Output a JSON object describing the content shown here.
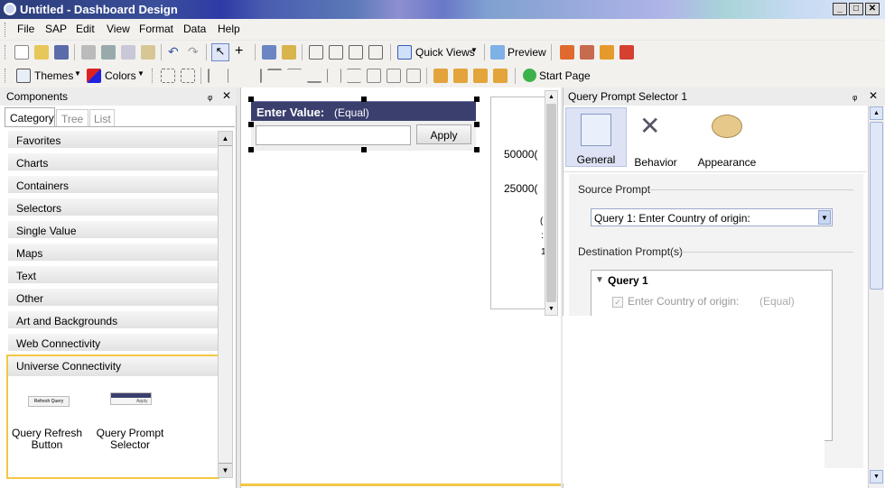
{
  "window": {
    "title": "Untitled - Dashboard Design",
    "min_glyph": "_",
    "max_glyph": "□",
    "close_glyph": "✕"
  },
  "menu": [
    "File",
    "SAP",
    "Edit",
    "View",
    "Format",
    "Data",
    "Help"
  ],
  "toolbar1": {
    "quick_views": "Quick Views",
    "preview": "Preview"
  },
  "toolbar2": {
    "themes": "Themes",
    "colors": "Colors",
    "start_page": "Start Page"
  },
  "components": {
    "title": "Components",
    "pin_glyph": "ᵩ",
    "close_glyph": "✕",
    "tabs": [
      "Category",
      "Tree",
      "List"
    ],
    "categories": [
      "Favorites",
      "Charts",
      "Containers",
      "Selectors",
      "Single Value",
      "Maps",
      "Text",
      "Other",
      "Art and Backgrounds",
      "Web Connectivity"
    ],
    "expanded": {
      "name": "Universe Connectivity",
      "items": [
        {
          "label": "Query Refresh Button",
          "line1": "Query Refresh",
          "line2": "Button",
          "thumb_text": "Refresh Query"
        },
        {
          "label": "Query Prompt Selector",
          "line1": "Query Prompt",
          "line2": "Selector",
          "thumb_text": "Apply"
        }
      ]
    }
  },
  "canvas": {
    "widget_title": "Enter Value:",
    "widget_subtitle": "(Equal)",
    "apply_label": "Apply",
    "input_value": "",
    "chart_labels": [
      "50000(",
      "25000(",
      "(",
      ":",
      "1"
    ]
  },
  "properties": {
    "title": "Query Prompt Selector 1",
    "pin_glyph": "ᵩ",
    "close_glyph": "✕",
    "tabs": [
      "General",
      "Behavior",
      "Appearance"
    ],
    "source_prompt_label": "Source Prompt",
    "source_prompt_value": "Query 1: Enter Country of origin:",
    "destination_label": "Destination Prompt(s)",
    "query_group": "Query 1",
    "query_item": "Enter Country of origin:",
    "query_item_suffix": "(Equal)"
  },
  "colors": {
    "widget_header": "#3b3f6e",
    "highlight": "#f2c744",
    "selected_tab": "#dde3f4"
  }
}
